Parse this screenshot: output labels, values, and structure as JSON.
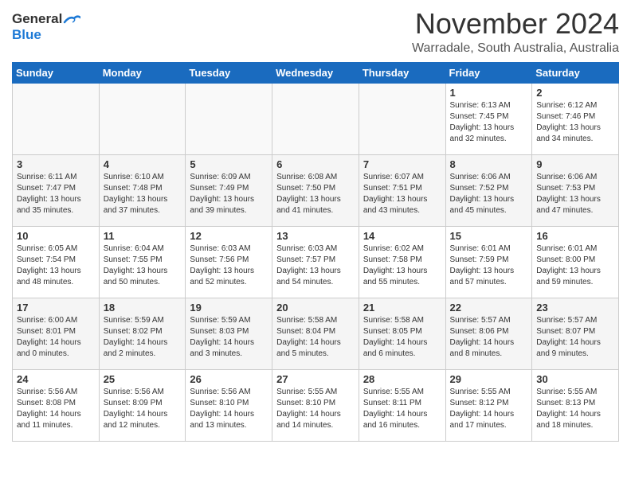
{
  "header": {
    "logo_general": "General",
    "logo_blue": "Blue",
    "month": "November 2024",
    "location": "Warradale, South Australia, Australia"
  },
  "days_of_week": [
    "Sunday",
    "Monday",
    "Tuesday",
    "Wednesday",
    "Thursday",
    "Friday",
    "Saturday"
  ],
  "weeks": [
    [
      {
        "day": "",
        "info": ""
      },
      {
        "day": "",
        "info": ""
      },
      {
        "day": "",
        "info": ""
      },
      {
        "day": "",
        "info": ""
      },
      {
        "day": "",
        "info": ""
      },
      {
        "day": "1",
        "info": "Sunrise: 6:13 AM\nSunset: 7:45 PM\nDaylight: 13 hours\nand 32 minutes."
      },
      {
        "day": "2",
        "info": "Sunrise: 6:12 AM\nSunset: 7:46 PM\nDaylight: 13 hours\nand 34 minutes."
      }
    ],
    [
      {
        "day": "3",
        "info": "Sunrise: 6:11 AM\nSunset: 7:47 PM\nDaylight: 13 hours\nand 35 minutes."
      },
      {
        "day": "4",
        "info": "Sunrise: 6:10 AM\nSunset: 7:48 PM\nDaylight: 13 hours\nand 37 minutes."
      },
      {
        "day": "5",
        "info": "Sunrise: 6:09 AM\nSunset: 7:49 PM\nDaylight: 13 hours\nand 39 minutes."
      },
      {
        "day": "6",
        "info": "Sunrise: 6:08 AM\nSunset: 7:50 PM\nDaylight: 13 hours\nand 41 minutes."
      },
      {
        "day": "7",
        "info": "Sunrise: 6:07 AM\nSunset: 7:51 PM\nDaylight: 13 hours\nand 43 minutes."
      },
      {
        "day": "8",
        "info": "Sunrise: 6:06 AM\nSunset: 7:52 PM\nDaylight: 13 hours\nand 45 minutes."
      },
      {
        "day": "9",
        "info": "Sunrise: 6:06 AM\nSunset: 7:53 PM\nDaylight: 13 hours\nand 47 minutes."
      }
    ],
    [
      {
        "day": "10",
        "info": "Sunrise: 6:05 AM\nSunset: 7:54 PM\nDaylight: 13 hours\nand 48 minutes."
      },
      {
        "day": "11",
        "info": "Sunrise: 6:04 AM\nSunset: 7:55 PM\nDaylight: 13 hours\nand 50 minutes."
      },
      {
        "day": "12",
        "info": "Sunrise: 6:03 AM\nSunset: 7:56 PM\nDaylight: 13 hours\nand 52 minutes."
      },
      {
        "day": "13",
        "info": "Sunrise: 6:03 AM\nSunset: 7:57 PM\nDaylight: 13 hours\nand 54 minutes."
      },
      {
        "day": "14",
        "info": "Sunrise: 6:02 AM\nSunset: 7:58 PM\nDaylight: 13 hours\nand 55 minutes."
      },
      {
        "day": "15",
        "info": "Sunrise: 6:01 AM\nSunset: 7:59 PM\nDaylight: 13 hours\nand 57 minutes."
      },
      {
        "day": "16",
        "info": "Sunrise: 6:01 AM\nSunset: 8:00 PM\nDaylight: 13 hours\nand 59 minutes."
      }
    ],
    [
      {
        "day": "17",
        "info": "Sunrise: 6:00 AM\nSunset: 8:01 PM\nDaylight: 14 hours\nand 0 minutes."
      },
      {
        "day": "18",
        "info": "Sunrise: 5:59 AM\nSunset: 8:02 PM\nDaylight: 14 hours\nand 2 minutes."
      },
      {
        "day": "19",
        "info": "Sunrise: 5:59 AM\nSunset: 8:03 PM\nDaylight: 14 hours\nand 3 minutes."
      },
      {
        "day": "20",
        "info": "Sunrise: 5:58 AM\nSunset: 8:04 PM\nDaylight: 14 hours\nand 5 minutes."
      },
      {
        "day": "21",
        "info": "Sunrise: 5:58 AM\nSunset: 8:05 PM\nDaylight: 14 hours\nand 6 minutes."
      },
      {
        "day": "22",
        "info": "Sunrise: 5:57 AM\nSunset: 8:06 PM\nDaylight: 14 hours\nand 8 minutes."
      },
      {
        "day": "23",
        "info": "Sunrise: 5:57 AM\nSunset: 8:07 PM\nDaylight: 14 hours\nand 9 minutes."
      }
    ],
    [
      {
        "day": "24",
        "info": "Sunrise: 5:56 AM\nSunset: 8:08 PM\nDaylight: 14 hours\nand 11 minutes."
      },
      {
        "day": "25",
        "info": "Sunrise: 5:56 AM\nSunset: 8:09 PM\nDaylight: 14 hours\nand 12 minutes."
      },
      {
        "day": "26",
        "info": "Sunrise: 5:56 AM\nSunset: 8:10 PM\nDaylight: 14 hours\nand 13 minutes."
      },
      {
        "day": "27",
        "info": "Sunrise: 5:55 AM\nSunset: 8:10 PM\nDaylight: 14 hours\nand 14 minutes."
      },
      {
        "day": "28",
        "info": "Sunrise: 5:55 AM\nSunset: 8:11 PM\nDaylight: 14 hours\nand 16 minutes."
      },
      {
        "day": "29",
        "info": "Sunrise: 5:55 AM\nSunset: 8:12 PM\nDaylight: 14 hours\nand 17 minutes."
      },
      {
        "day": "30",
        "info": "Sunrise: 5:55 AM\nSunset: 8:13 PM\nDaylight: 14 hours\nand 18 minutes."
      }
    ]
  ]
}
